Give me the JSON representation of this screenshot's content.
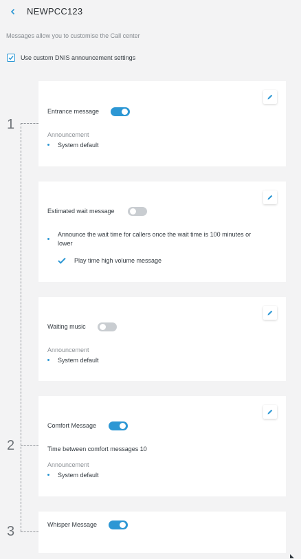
{
  "header": {
    "title": "NEWPCC123"
  },
  "subtitle": "Messages allow you to customise the Call center",
  "dnis": {
    "label": "Use custom DNIS announcement settings",
    "checked": true
  },
  "steps": [
    "1",
    "2",
    "3"
  ],
  "cards": {
    "entrance": {
      "label": "Entrance message",
      "enabled": true,
      "announcement_label": "Announcement",
      "announcement_value": "System default"
    },
    "estimated_wait": {
      "label": "Estimated wait message",
      "enabled": false,
      "bullet": "Announce the wait time for callers once the wait time is 100 minutes or lower",
      "high_volume": "Play time high volume message"
    },
    "waiting_music": {
      "label": "Waiting music",
      "enabled": false,
      "announcement_label": "Announcement",
      "announcement_value": "System default"
    },
    "comfort": {
      "label": "Comfort Message",
      "enabled": true,
      "time_between": "Time between comfort messages 10",
      "announcement_label": "Announcement",
      "announcement_value": "System default"
    },
    "whisper": {
      "label": "Whisper Message",
      "enabled": true
    }
  },
  "colors": {
    "accent": "#2c97d4",
    "toggle_off": "#c9cdd1",
    "background": "#f3f3f4",
    "card": "#ffffff"
  }
}
